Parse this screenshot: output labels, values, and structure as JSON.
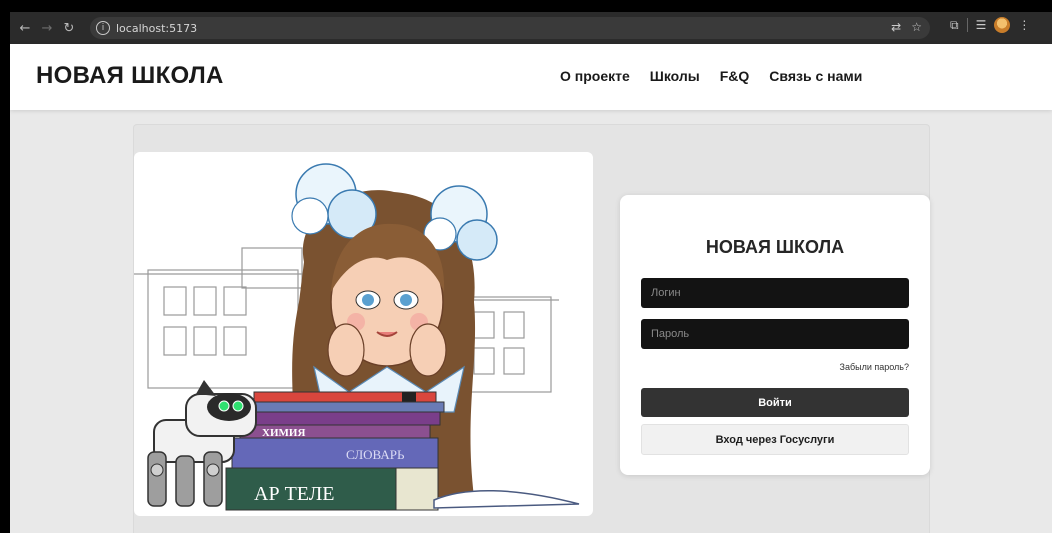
{
  "browser": {
    "url": "localhost:5173",
    "icons": [
      "back-icon",
      "forward-icon",
      "reload-icon",
      "site-info-icon",
      "translate-icon",
      "star-icon",
      "extensions-icon",
      "reading-list-icon",
      "profile-icon",
      "menu-icon"
    ]
  },
  "header": {
    "logo": "НОВАЯ ШКОЛА",
    "nav": [
      {
        "label": "О проекте"
      },
      {
        "label": "Школы"
      },
      {
        "label": "F&Q"
      },
      {
        "label": "Связь с нами"
      }
    ]
  },
  "illustration": {
    "books": [
      "ХИМИЯ",
      "СЛОВАРЬ",
      "АР ТЕЛЕ"
    ]
  },
  "login": {
    "title": "НОВАЯ ШКОЛА",
    "login_placeholder": "Логин",
    "password_placeholder": "Пароль",
    "forgot": "Забыли пароль?",
    "submit": "Войти",
    "gosuslugi": "Вход через Госуслуги"
  },
  "colors": {
    "field_bg": "#131313",
    "primary_button": "#333333",
    "secondary_button": "#f1f1f1",
    "page_bg": "#e9e9e9"
  }
}
